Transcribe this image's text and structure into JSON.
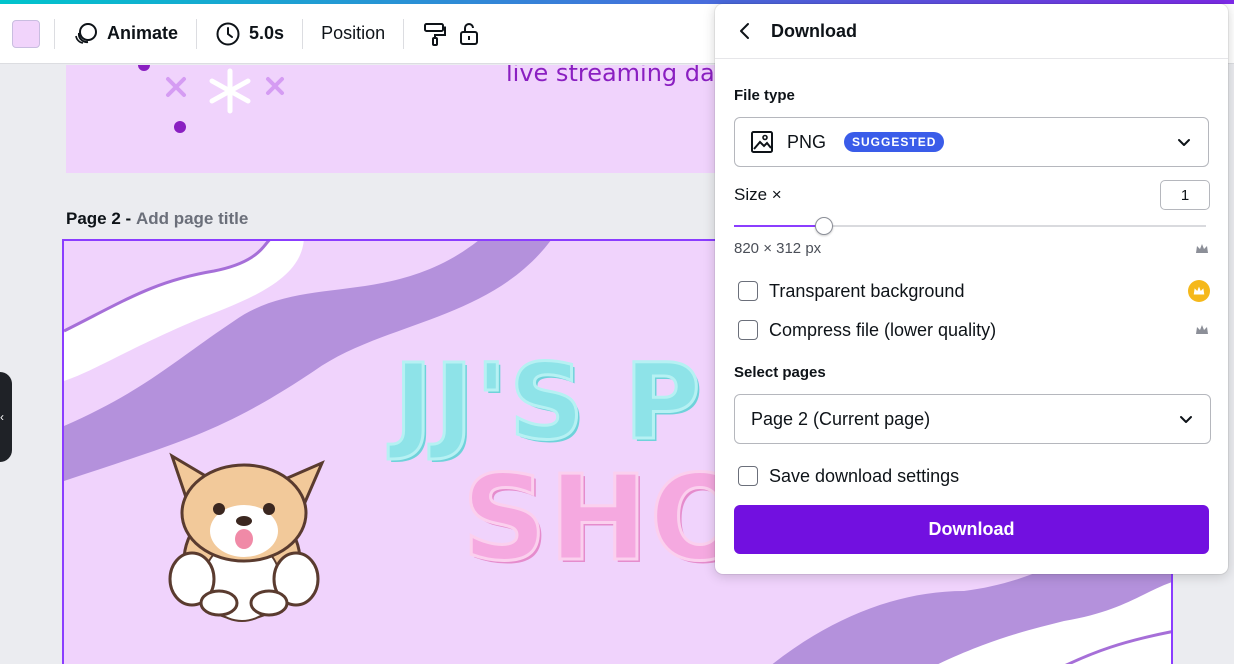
{
  "toolbar": {
    "swatch_color": "#f1d4fb",
    "animate_label": "Animate",
    "duration_label": "5.0s",
    "position_label": "Position"
  },
  "canvas": {
    "page1_text": "live streaming dail",
    "page2_title_number": "Page 2 -",
    "page2_title_placeholder": "Add page title",
    "page2_text_line1": "JJ'S P",
    "page2_text_line2": "SHO"
  },
  "panel": {
    "title": "Download",
    "file_type_label": "File type",
    "file_type_value": "PNG",
    "file_type_badge": "SUGGESTED",
    "size_label": "Size ×",
    "size_value": "1",
    "size_slider_fraction": 0.19,
    "dimensions": "820 × 312 px",
    "transparent_label": "Transparent background",
    "compress_label": "Compress file (lower quality)",
    "select_pages_label": "Select pages",
    "select_pages_value": "Page 2 (Current page)",
    "save_settings_label": "Save download settings",
    "download_button_label": "Download"
  },
  "colors": {
    "accent": "#7210e0",
    "badge": "#3a5ce9",
    "canvas_bg": "#f0d3fc",
    "premium_gold": "#f5b81b"
  },
  "icons": [
    "animate-icon",
    "clock-icon",
    "paint-roller-icon",
    "lock-icon",
    "back-arrow-icon",
    "image-file-icon",
    "chevron-down-icon",
    "crown-icon"
  ]
}
